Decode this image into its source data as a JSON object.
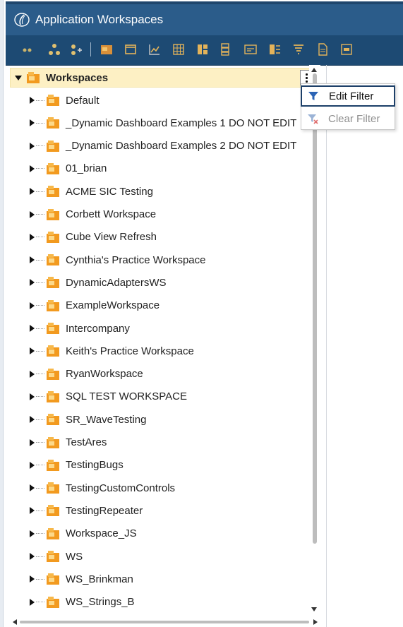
{
  "window": {
    "title": "Application Workspaces"
  },
  "toolbar": {
    "icons": [
      "dots-icon",
      "hierarchy-icon",
      "add-hierarchy-icon",
      "workspace-icon",
      "window-icon",
      "chart-icon",
      "grid-icon",
      "panel-icon",
      "list-icon",
      "form-icon",
      "split-icon",
      "filter-icon",
      "document-icon",
      "component-icon"
    ]
  },
  "tree": {
    "root_label": "Workspaces",
    "items": [
      "Default",
      "_Dynamic Dashboard Examples 1 DO NOT EDIT",
      "_Dynamic Dashboard Examples 2 DO NOT EDIT",
      "01_brian",
      "ACME SIC Testing",
      "Corbett Workspace",
      "Cube View Refresh",
      "Cynthia's Practice Workspace",
      "DynamicAdaptersWS",
      "ExampleWorkspace",
      "Intercompany",
      "Keith's Practice Workspace",
      "RyanWorkspace",
      "SQL TEST WORKSPACE",
      "SR_WaveTesting",
      "TestAres",
      "TestingBugs",
      "TestingCustomControls",
      "TestingRepeater",
      "Workspace_JS",
      "WS",
      "WS_Brinkman",
      "WS_Strings_B"
    ]
  },
  "context_menu": {
    "edit_filter": "Edit Filter",
    "clear_filter": "Clear Filter"
  },
  "colors": {
    "titlebar": "#2b5c8a",
    "toolbar": "#1d4a73",
    "selected_row": "#fdf0c4",
    "folder_orange": "#f29a1f",
    "filter_blue": "#2c64b5"
  }
}
